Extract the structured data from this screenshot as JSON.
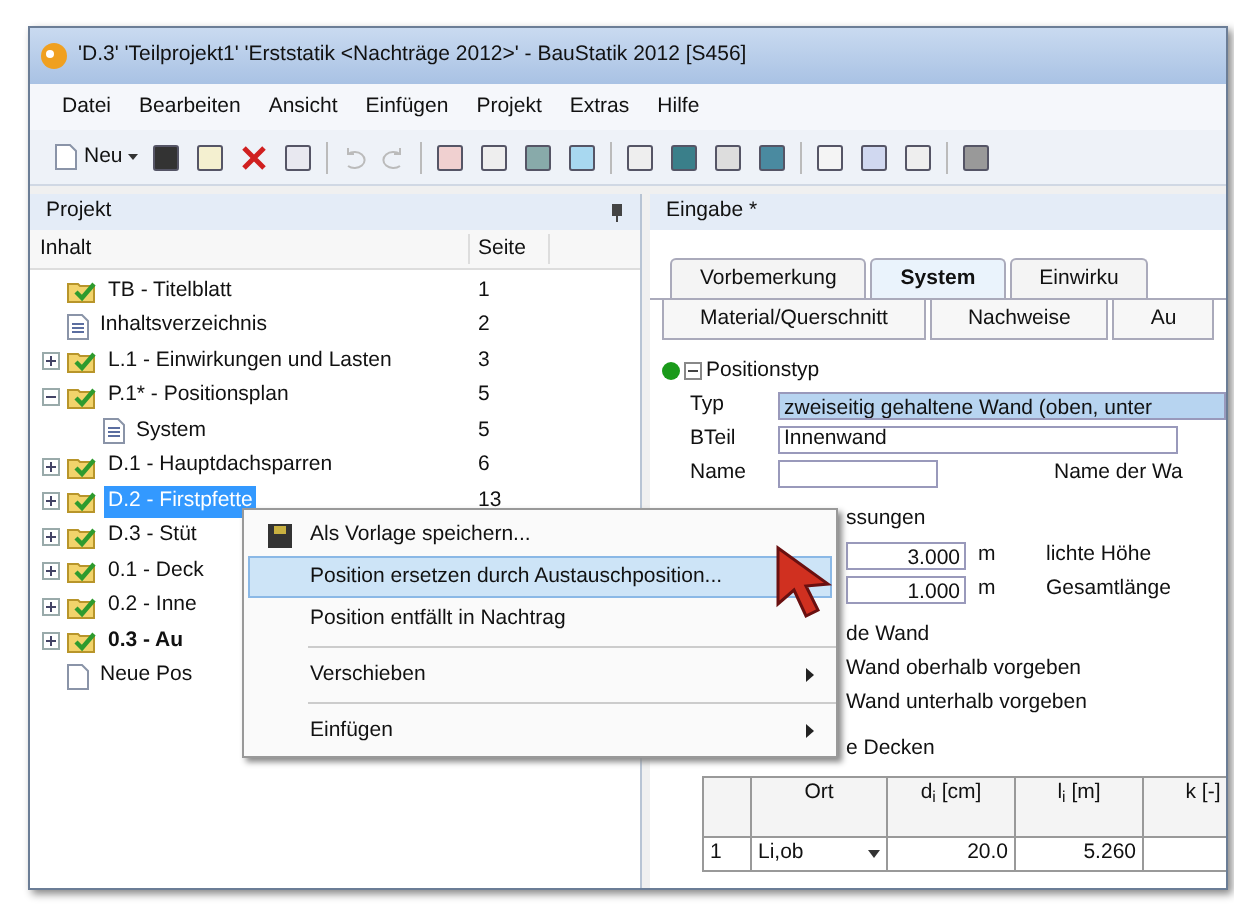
{
  "window": {
    "title": "'D.3' 'Teilprojekt1' 'Erststatik <Nachträge 2012>' - BauStatik 2012 [S456]"
  },
  "menu": [
    "Datei",
    "Bearbeiten",
    "Ansicht",
    "Einfügen",
    "Projekt",
    "Extras",
    "Hilfe"
  ],
  "toolbar": {
    "new_label": "Neu"
  },
  "project_panel": {
    "title": "Projekt",
    "columns": [
      "Inhalt",
      "Seite"
    ],
    "items": [
      {
        "label": "TB - Titelblatt",
        "page": "1",
        "kind": "folder",
        "selected": false,
        "bold": false
      },
      {
        "label": "Inhaltsverzeichnis",
        "page": "2",
        "kind": "page",
        "selected": false,
        "bold": false
      },
      {
        "label": "L.1 - Einwirkungen und Lasten",
        "page": "3",
        "kind": "folder",
        "selected": false,
        "bold": false,
        "expanded": false
      },
      {
        "label": "P.1* - Positionsplan",
        "page": "5",
        "kind": "folder",
        "selected": false,
        "bold": false,
        "expanded": true,
        "children": [
          {
            "label": "System",
            "page": "5",
            "kind": "page",
            "selected": false,
            "bold": false
          }
        ]
      },
      {
        "label": "D.1 - Hauptdachsparren",
        "page": "6",
        "kind": "folder",
        "selected": false,
        "bold": false,
        "expanded": false
      },
      {
        "label": "D.2 - Firstpfette",
        "page": "13",
        "kind": "folder",
        "selected": true,
        "bold": false,
        "expanded": false
      },
      {
        "label": "D.3 - Stüt",
        "kind": "folder",
        "selected": false,
        "bold": false,
        "expanded": false
      },
      {
        "label": "0.1 - Deck",
        "kind": "folder",
        "selected": false,
        "bold": false,
        "expanded": false
      },
      {
        "label": "0.2 - Inne",
        "kind": "folder",
        "selected": false,
        "bold": false,
        "expanded": false
      },
      {
        "label": "0.3 - Au",
        "kind": "folder",
        "selected": false,
        "bold": true,
        "expanded": false
      },
      {
        "label": "Neue Pos",
        "kind": "new",
        "selected": false,
        "bold": false
      }
    ]
  },
  "context_menu": [
    {
      "label": "Als Vorlage speichern...",
      "kind": "item",
      "icon": true,
      "selected": false,
      "submenu": false
    },
    {
      "label": "Position ersetzen durch Austauschposition...",
      "kind": "item",
      "icon": false,
      "selected": true,
      "submenu": false
    },
    {
      "label": "Position entfällt in Nachtrag",
      "kind": "item",
      "icon": false,
      "selected": false,
      "submenu": false
    },
    {
      "kind": "separator"
    },
    {
      "label": "Verschieben",
      "kind": "item",
      "icon": false,
      "selected": false,
      "submenu": true
    },
    {
      "kind": "separator"
    },
    {
      "label": "Einfügen",
      "kind": "item",
      "icon": false,
      "selected": false,
      "submenu": true
    }
  ],
  "input_panel": {
    "title": "Eingabe *",
    "tabs_row1": [
      {
        "label": "Vorbemerkung",
        "selected": false
      },
      {
        "label": "System",
        "selected": true
      },
      {
        "label": "Einwirku",
        "selected": false
      }
    ],
    "tabs_row2": [
      {
        "label": "Material/Querschnitt",
        "selected": false
      },
      {
        "label": "Nachweise",
        "selected": false
      },
      {
        "label": "Au",
        "selected": false
      }
    ],
    "section": "Positionstyp",
    "typ": {
      "label": "Typ",
      "value": "zweiseitig gehaltene Wand (oben, unter"
    },
    "bteil": {
      "label": "BTeil",
      "value": "Innenwand"
    },
    "name": {
      "label": "Name",
      "hint": "Name der Wa"
    },
    "dims_heading": "ssungen",
    "dims": [
      {
        "value": "3.000",
        "unit": "m",
        "label": "lichte Höhe"
      },
      {
        "value": "1.000",
        "unit": "m",
        "label": "Gesamtlänge"
      }
    ],
    "wall_heading": "de Wand",
    "wall_options": [
      "Wand oberhalb vorgeben",
      "Wand unterhalb vorgeben"
    ],
    "decks_heading": "e Decken",
    "table": {
      "columns": [
        "Ort",
        "d$_{i}$ [cm]",
        "l$_{i}$ [m]",
        "k [-]"
      ],
      "rows": [
        {
          "index": "1",
          "ort": "Li,ob",
          "d": "20.0",
          "l": "5.260",
          "k": ""
        }
      ]
    }
  }
}
